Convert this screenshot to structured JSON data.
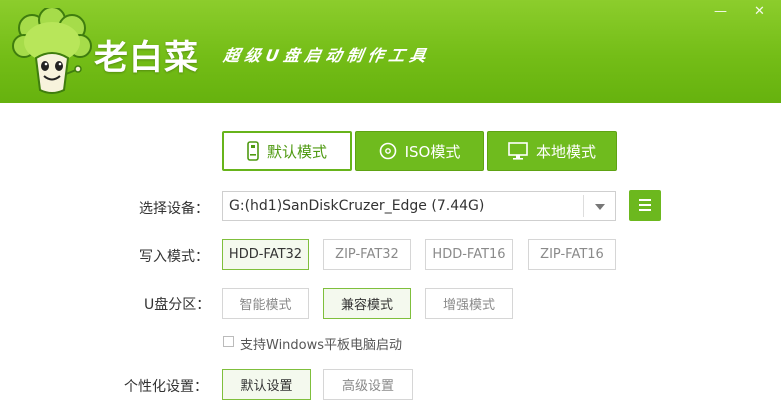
{
  "app": {
    "brand": "老白菜",
    "slogan": "超级U盘启动制作工具"
  },
  "modes": [
    {
      "label": "默认模式",
      "icon": "usb-drive-icon",
      "selected": true
    },
    {
      "label": "ISO模式",
      "icon": "disc-icon",
      "selected": false
    },
    {
      "label": "本地模式",
      "icon": "monitor-icon",
      "selected": false
    }
  ],
  "device": {
    "label": "选择设备：",
    "value": "G:(hd1)SanDiskCruzer_Edge (7.44G)"
  },
  "write_mode": {
    "label": "写入模式：",
    "options": [
      "HDD-FAT32",
      "ZIP-FAT32",
      "HDD-FAT16",
      "ZIP-FAT16"
    ],
    "selected": "HDD-FAT32"
  },
  "partition": {
    "label": "U盘分区：",
    "options": [
      "智能模式",
      "兼容模式",
      "增强模式"
    ],
    "selected": "兼容模式"
  },
  "windows_tablet": {
    "label": "支持Windows平板电脑启动",
    "checked": false
  },
  "personalize": {
    "label": "个性化设置：",
    "options": [
      "默认设置",
      "高级设置"
    ],
    "selected": "默认设置"
  },
  "colors": {
    "accent": "#6cb81e",
    "header_top": "#8ccd2c",
    "header_bottom": "#66b20e"
  }
}
